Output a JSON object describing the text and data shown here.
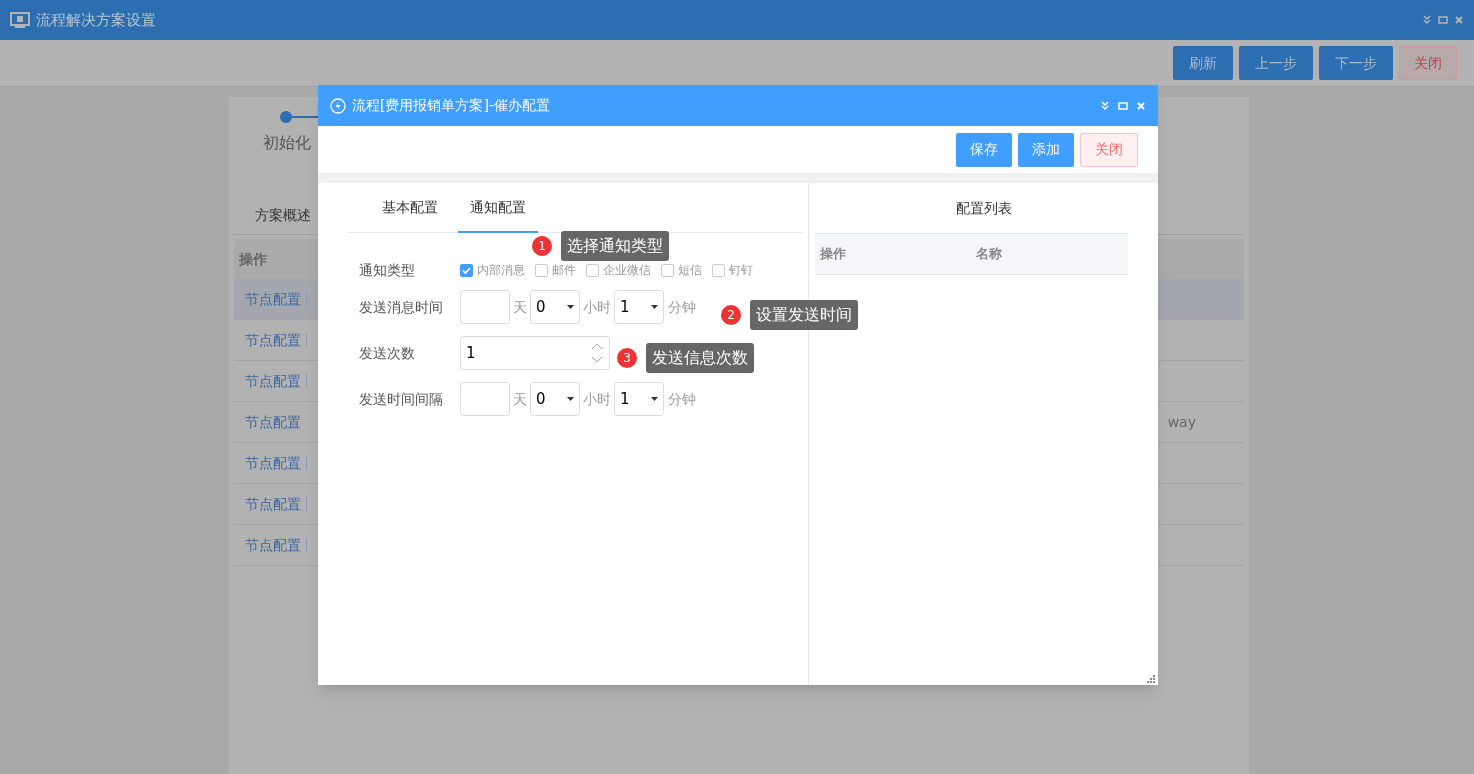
{
  "window": {
    "title": "流程解决方案设置"
  },
  "toolbar": {
    "buttons": [
      {
        "label": "刷新",
        "kind": "primary"
      },
      {
        "label": "上一步",
        "kind": "primary"
      },
      {
        "label": "下一步",
        "kind": "primary"
      },
      {
        "label": "关闭",
        "kind": "danger"
      }
    ]
  },
  "steps": [
    {
      "label": "初始化",
      "selected": true
    }
  ],
  "page_tabs": [
    {
      "label": "方案概述",
      "selected": true
    }
  ],
  "table": {
    "columns": [
      "操作"
    ],
    "rows": [
      {
        "action": "节点配置",
        "separator": true,
        "selected": true
      },
      {
        "action": "节点配置",
        "separator": true,
        "selected": false
      },
      {
        "action": "节点配置",
        "separator": true,
        "selected": false
      },
      {
        "action": "节点配置",
        "separator": false,
        "selected": false,
        "column_2": "way"
      },
      {
        "action": "节点配置",
        "separator": true,
        "selected": false
      },
      {
        "action": "节点配置",
        "separator": true,
        "selected": false
      },
      {
        "action": "节点配置",
        "separator": true,
        "selected": false
      }
    ]
  },
  "dialog": {
    "title": "流程[费用报销单方案]-催办配置",
    "buttons": [
      {
        "label": "保存",
        "kind": "primary"
      },
      {
        "label": "添加",
        "kind": "primary"
      },
      {
        "label": "关闭",
        "kind": "danger"
      }
    ],
    "tabs": [
      {
        "label": "基本配置",
        "selected": false
      },
      {
        "label": "通知配置",
        "selected": true
      }
    ],
    "notify_type": {
      "label": "通知类型",
      "options": [
        {
          "label": "内部消息",
          "checked": true
        },
        {
          "label": "邮件",
          "checked": false
        },
        {
          "label": "企业微信",
          "checked": false
        },
        {
          "label": "短信",
          "checked": false
        },
        {
          "label": "钉钉",
          "checked": false
        }
      ]
    },
    "send_time": {
      "label": "发送消息时间",
      "day_unit": "天",
      "hours": "0",
      "hour_unit": "小时",
      "minutes": "1",
      "minute_unit": "分钟"
    },
    "send_count": {
      "label": "发送次数",
      "value": "1"
    },
    "interval": {
      "label": "发送时间间隔",
      "day_unit": "天",
      "hours": "0",
      "hour_unit": "小时",
      "minutes": "1",
      "minute_unit": "分钟"
    },
    "list": {
      "title": "配置列表",
      "columns": [
        "操作",
        "名称"
      ]
    }
  },
  "callouts": [
    {
      "number": "1",
      "text": "选择通知类型"
    },
    {
      "number": "2",
      "text": "设置发送时间"
    },
    {
      "number": "3",
      "text": "发送信息次数"
    }
  ]
}
